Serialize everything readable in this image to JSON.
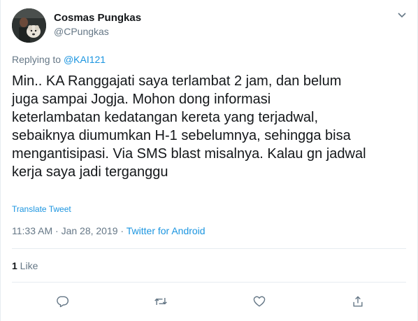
{
  "author": {
    "name": "Cosmas Pungkas",
    "handle": "@CPungkas"
  },
  "reply": {
    "prefix": "Replying to ",
    "mention": "@KAI121"
  },
  "tweet": {
    "text": "Min.. KA Ranggajati saya terlambat 2 jam, dan belum\njuga sampai Jogja. Mohon dong informasi\nketerlambatan kedatangan kereta yang terjadwal,\nsebaiknya diumumkan H-1 sebelumnya, sehingga bisa\nmengantisipasi. Via SMS blast misalnya. Kalau gn jadwal\nkerja saya jadi terganggu",
    "translate_label": "Translate Tweet",
    "time": "11:33 AM",
    "date": "Jan 28, 2019",
    "separator": " · ",
    "source": "Twitter for Android"
  },
  "stats": {
    "like_count": "1",
    "like_label": " Like"
  },
  "icons": {
    "menu": "chevron-down-icon",
    "reply": "reply-icon",
    "retweet": "retweet-icon",
    "like": "heart-icon",
    "share": "share-icon"
  },
  "colors": {
    "link": "#1b95e0",
    "secondary_text": "#657786",
    "divider": "#e6ecf0"
  }
}
